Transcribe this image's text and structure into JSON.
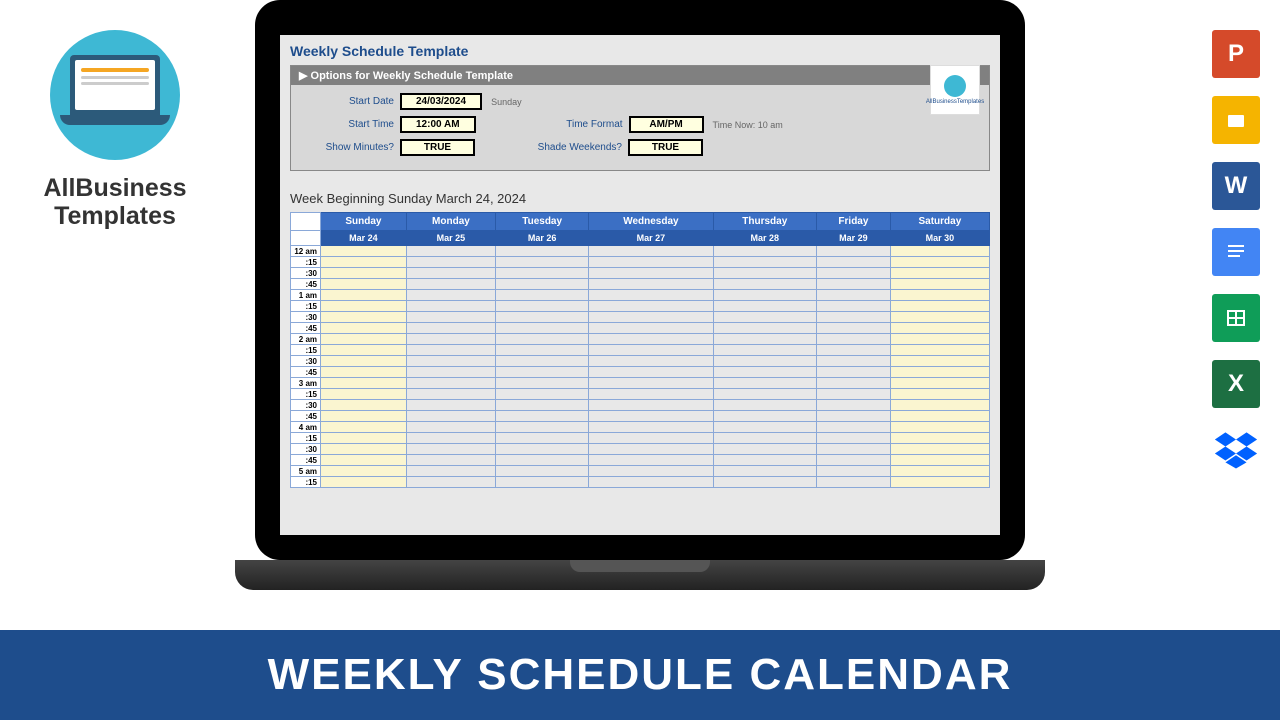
{
  "logo": {
    "line1": "AllBusiness",
    "line2": "Templates"
  },
  "doc": {
    "title": "Weekly Schedule Template",
    "options_header": "▶ Options for Weekly Schedule Template",
    "start_date_label": "Start Date",
    "start_date_value": "24/03/2024",
    "start_date_day": "Sunday",
    "start_time_label": "Start Time",
    "start_time_value": "12:00 AM",
    "time_format_label": "Time Format",
    "time_format_value": "AM/PM",
    "time_now_note": "Time Now: 10 am",
    "show_minutes_label": "Show Minutes?",
    "show_minutes_value": "TRUE",
    "shade_weekends_label": "Shade Weekends?",
    "shade_weekends_value": "TRUE",
    "badge_text": "AllBusinessTemplates"
  },
  "calendar": {
    "week_title": "Week Beginning Sunday March 24, 2024",
    "days": [
      "Sunday",
      "Monday",
      "Tuesday",
      "Wednesday",
      "Thursday",
      "Friday",
      "Saturday"
    ],
    "dates": [
      "Mar 24",
      "Mar 25",
      "Mar 26",
      "Mar 27",
      "Mar 28",
      "Mar 29",
      "Mar 30"
    ],
    "time_rows": [
      "12 am",
      ":15",
      ":30",
      ":45",
      "1 am",
      ":15",
      ":30",
      ":45",
      "2 am",
      ":15",
      ":30",
      ":45",
      "3 am",
      ":15",
      ":30",
      ":45",
      "4 am",
      ":15",
      ":30",
      ":45",
      "5 am",
      ":15"
    ]
  },
  "icons": {
    "powerpoint": "P",
    "slides": "",
    "word": "W",
    "docs": "",
    "sheets": "",
    "excel": "X",
    "dropbox": ""
  },
  "banner": "WEEKLY SCHEDULE CALENDAR"
}
